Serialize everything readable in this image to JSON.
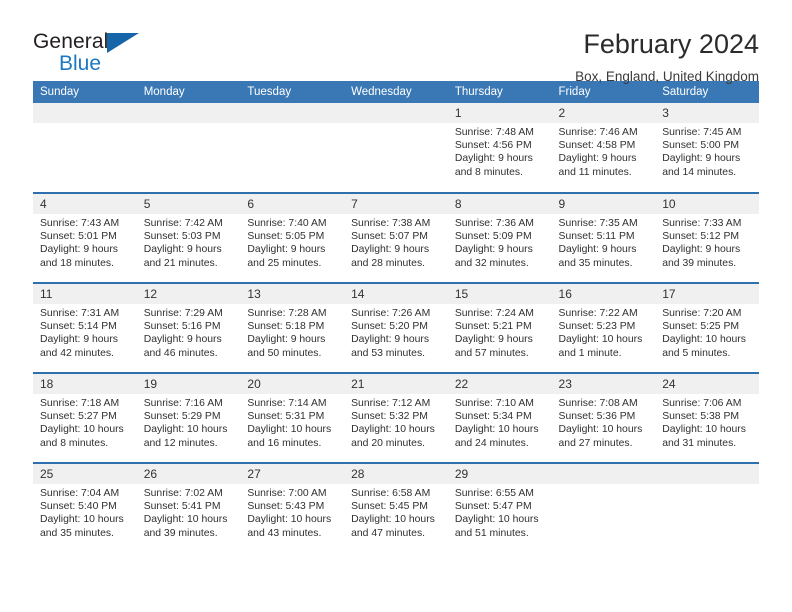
{
  "brand": {
    "name_part1": "General",
    "name_part2": "Blue",
    "logo_colors": {
      "dark": "#231f20",
      "blue": "#1b79c4",
      "triangle": "#1565a8"
    }
  },
  "header": {
    "title": "February 2024",
    "subtitle": "Box, England, United Kingdom"
  },
  "theme": {
    "header_bg": "#3a78b5",
    "row_border": "#2f6fae",
    "daynum_bg": "#f0f0f0"
  },
  "weekday_headers": [
    "Sunday",
    "Monday",
    "Tuesday",
    "Wednesday",
    "Thursday",
    "Friday",
    "Saturday"
  ],
  "weeks": [
    [
      {
        "day": "",
        "lines": []
      },
      {
        "day": "",
        "lines": []
      },
      {
        "day": "",
        "lines": []
      },
      {
        "day": "",
        "lines": []
      },
      {
        "day": "1",
        "lines": [
          "Sunrise: 7:48 AM",
          "Sunset: 4:56 PM",
          "Daylight: 9 hours",
          "and 8 minutes."
        ]
      },
      {
        "day": "2",
        "lines": [
          "Sunrise: 7:46 AM",
          "Sunset: 4:58 PM",
          "Daylight: 9 hours",
          "and 11 minutes."
        ]
      },
      {
        "day": "3",
        "lines": [
          "Sunrise: 7:45 AM",
          "Sunset: 5:00 PM",
          "Daylight: 9 hours",
          "and 14 minutes."
        ]
      }
    ],
    [
      {
        "day": "4",
        "lines": [
          "Sunrise: 7:43 AM",
          "Sunset: 5:01 PM",
          "Daylight: 9 hours",
          "and 18 minutes."
        ]
      },
      {
        "day": "5",
        "lines": [
          "Sunrise: 7:42 AM",
          "Sunset: 5:03 PM",
          "Daylight: 9 hours",
          "and 21 minutes."
        ]
      },
      {
        "day": "6",
        "lines": [
          "Sunrise: 7:40 AM",
          "Sunset: 5:05 PM",
          "Daylight: 9 hours",
          "and 25 minutes."
        ]
      },
      {
        "day": "7",
        "lines": [
          "Sunrise: 7:38 AM",
          "Sunset: 5:07 PM",
          "Daylight: 9 hours",
          "and 28 minutes."
        ]
      },
      {
        "day": "8",
        "lines": [
          "Sunrise: 7:36 AM",
          "Sunset: 5:09 PM",
          "Daylight: 9 hours",
          "and 32 minutes."
        ]
      },
      {
        "day": "9",
        "lines": [
          "Sunrise: 7:35 AM",
          "Sunset: 5:11 PM",
          "Daylight: 9 hours",
          "and 35 minutes."
        ]
      },
      {
        "day": "10",
        "lines": [
          "Sunrise: 7:33 AM",
          "Sunset: 5:12 PM",
          "Daylight: 9 hours",
          "and 39 minutes."
        ]
      }
    ],
    [
      {
        "day": "11",
        "lines": [
          "Sunrise: 7:31 AM",
          "Sunset: 5:14 PM",
          "Daylight: 9 hours",
          "and 42 minutes."
        ]
      },
      {
        "day": "12",
        "lines": [
          "Sunrise: 7:29 AM",
          "Sunset: 5:16 PM",
          "Daylight: 9 hours",
          "and 46 minutes."
        ]
      },
      {
        "day": "13",
        "lines": [
          "Sunrise: 7:28 AM",
          "Sunset: 5:18 PM",
          "Daylight: 9 hours",
          "and 50 minutes."
        ]
      },
      {
        "day": "14",
        "lines": [
          "Sunrise: 7:26 AM",
          "Sunset: 5:20 PM",
          "Daylight: 9 hours",
          "and 53 minutes."
        ]
      },
      {
        "day": "15",
        "lines": [
          "Sunrise: 7:24 AM",
          "Sunset: 5:21 PM",
          "Daylight: 9 hours",
          "and 57 minutes."
        ]
      },
      {
        "day": "16",
        "lines": [
          "Sunrise: 7:22 AM",
          "Sunset: 5:23 PM",
          "Daylight: 10 hours",
          "and 1 minute."
        ]
      },
      {
        "day": "17",
        "lines": [
          "Sunrise: 7:20 AM",
          "Sunset: 5:25 PM",
          "Daylight: 10 hours",
          "and 5 minutes."
        ]
      }
    ],
    [
      {
        "day": "18",
        "lines": [
          "Sunrise: 7:18 AM",
          "Sunset: 5:27 PM",
          "Daylight: 10 hours",
          "and 8 minutes."
        ]
      },
      {
        "day": "19",
        "lines": [
          "Sunrise: 7:16 AM",
          "Sunset: 5:29 PM",
          "Daylight: 10 hours",
          "and 12 minutes."
        ]
      },
      {
        "day": "20",
        "lines": [
          "Sunrise: 7:14 AM",
          "Sunset: 5:31 PM",
          "Daylight: 10 hours",
          "and 16 minutes."
        ]
      },
      {
        "day": "21",
        "lines": [
          "Sunrise: 7:12 AM",
          "Sunset: 5:32 PM",
          "Daylight: 10 hours",
          "and 20 minutes."
        ]
      },
      {
        "day": "22",
        "lines": [
          "Sunrise: 7:10 AM",
          "Sunset: 5:34 PM",
          "Daylight: 10 hours",
          "and 24 minutes."
        ]
      },
      {
        "day": "23",
        "lines": [
          "Sunrise: 7:08 AM",
          "Sunset: 5:36 PM",
          "Daylight: 10 hours",
          "and 27 minutes."
        ]
      },
      {
        "day": "24",
        "lines": [
          "Sunrise: 7:06 AM",
          "Sunset: 5:38 PM",
          "Daylight: 10 hours",
          "and 31 minutes."
        ]
      }
    ],
    [
      {
        "day": "25",
        "lines": [
          "Sunrise: 7:04 AM",
          "Sunset: 5:40 PM",
          "Daylight: 10 hours",
          "and 35 minutes."
        ]
      },
      {
        "day": "26",
        "lines": [
          "Sunrise: 7:02 AM",
          "Sunset: 5:41 PM",
          "Daylight: 10 hours",
          "and 39 minutes."
        ]
      },
      {
        "day": "27",
        "lines": [
          "Sunrise: 7:00 AM",
          "Sunset: 5:43 PM",
          "Daylight: 10 hours",
          "and 43 minutes."
        ]
      },
      {
        "day": "28",
        "lines": [
          "Sunrise: 6:58 AM",
          "Sunset: 5:45 PM",
          "Daylight: 10 hours",
          "and 47 minutes."
        ]
      },
      {
        "day": "29",
        "lines": [
          "Sunrise: 6:55 AM",
          "Sunset: 5:47 PM",
          "Daylight: 10 hours",
          "and 51 minutes."
        ]
      },
      {
        "day": "",
        "lines": []
      },
      {
        "day": "",
        "lines": []
      }
    ]
  ]
}
